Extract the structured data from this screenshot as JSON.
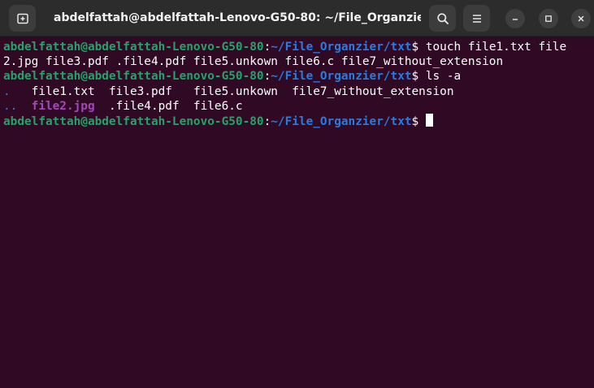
{
  "window": {
    "title": "abdelfattah@abdelfattah-Lenovo-G50-80: ~/File_Organzier/txt"
  },
  "titlebar": {
    "icons": [
      "new-tab-icon",
      "search-icon",
      "hamburger-menu-icon",
      "minimize-icon",
      "maximize-icon",
      "close-icon"
    ]
  },
  "colors": {
    "background": "#300a24",
    "prompt_user": "#26a269",
    "prompt_path": "#2a7bde",
    "image_file": "#a347ba",
    "text": "#ffffff"
  },
  "terminal": {
    "prompt_user": "abdelfattah@abdelfattah-Lenovo-G50-80",
    "prompt_sep": ":",
    "prompt_path": "~/File_Organzier/txt",
    "prompt_symbol": "$ ",
    "cmd1_part1": "touch file1.txt file",
    "cmd1_part2": "2.jpg file3.pdf .file4.pdf file5.unkown file6.c file7_without_extension",
    "cmd2": "ls -a",
    "ls": {
      "row1": {
        "dir": ".",
        "gap": "   ",
        "rest": "file1.txt  file3.pdf   file5.unkown  file7_without_extension"
      },
      "row2": {
        "dir": "..",
        "gap": "  ",
        "img": "file2.jpg",
        "rest": "  .file4.pdf  file6.c"
      }
    }
  }
}
